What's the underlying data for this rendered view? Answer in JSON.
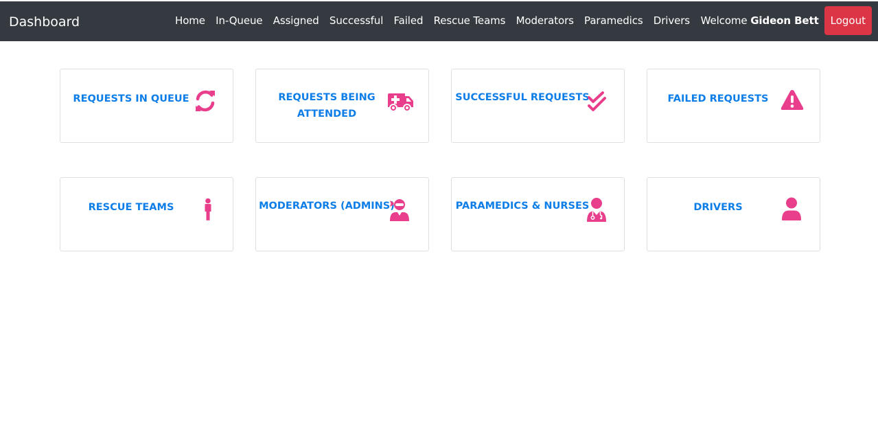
{
  "navbar": {
    "brand": "Dashboard",
    "links": [
      "Home",
      "In-Queue",
      "Assigned",
      "Successful",
      "Failed",
      "Rescue Teams",
      "Moderators",
      "Paramedics",
      "Drivers"
    ],
    "welcome_prefix": "Welcome",
    "user_name": "Gideon Bett",
    "logout_label": "Logout"
  },
  "colors": {
    "navbar_bg": "#343a40",
    "card_text": "#0d7ee8",
    "icon": "#e83e8c",
    "logout_bg": "#dc3545"
  },
  "cards": [
    {
      "label": "REQUESTS IN QUEUE",
      "icon": "sync-icon"
    },
    {
      "label": "REQUESTS BEING ATTENDED",
      "icon": "ambulance-icon"
    },
    {
      "label": "SUCCESSFUL REQUESTS",
      "icon": "double-check-icon"
    },
    {
      "label": "FAILED REQUESTS",
      "icon": "warning-triangle-icon"
    },
    {
      "label": "RESCUE TEAMS",
      "icon": "child-icon"
    },
    {
      "label": "MODERATORS (ADMINS)",
      "icon": "user-ninja-icon"
    },
    {
      "label": "PARAMEDICS & NURSES",
      "icon": "user-doctor-icon"
    },
    {
      "label": "DRIVERS",
      "icon": "user-icon"
    }
  ]
}
